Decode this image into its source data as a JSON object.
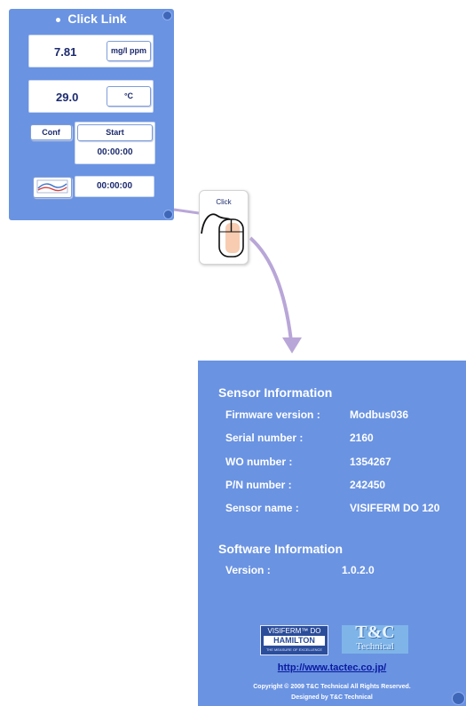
{
  "widget": {
    "title": "Click Link",
    "oxygen": {
      "value": "7.81",
      "unit_button": "mg/l ppm"
    },
    "temperature": {
      "value": "29.0",
      "unit_button": "°C"
    },
    "conf_button": "Conf",
    "start_button": "Start",
    "start_timer": "00:00:00",
    "graph_timer": "00:00:00",
    "colors": {
      "background": "#6a93e2",
      "text": "#1b2a6e"
    }
  },
  "click_icon": {
    "label": "Click",
    "icon": "mouse-icon"
  },
  "info_panel": {
    "sensor_heading": "Sensor Information",
    "sensor_rows": [
      {
        "key": "Firmware version :",
        "value": "Modbus036"
      },
      {
        "key": "Serial number :",
        "value": "2160"
      },
      {
        "key": "WO number :",
        "value": "1354267"
      },
      {
        "key": "P/N number :",
        "value": "242450"
      },
      {
        "key": "Sensor name :",
        "value": "VISIFERM DO 120"
      }
    ],
    "software_heading": "Software Information",
    "software_rows": [
      {
        "key": "Version :",
        "value": "1.0.2.0"
      }
    ],
    "logo_hamilton": {
      "line1": "VISIFERM™ DO",
      "line2": "HAMILTON",
      "line3": "THE MEASURE OF EXCELLENCE"
    },
    "logo_tc": {
      "line1": "T&C",
      "line2": "Technical"
    },
    "url": "http://www.tactec.co.jp/",
    "copyright": "Copyright © 2009 T&C Technical All Rights Reserved.",
    "designed_by": "Designed by T&C Technical"
  }
}
